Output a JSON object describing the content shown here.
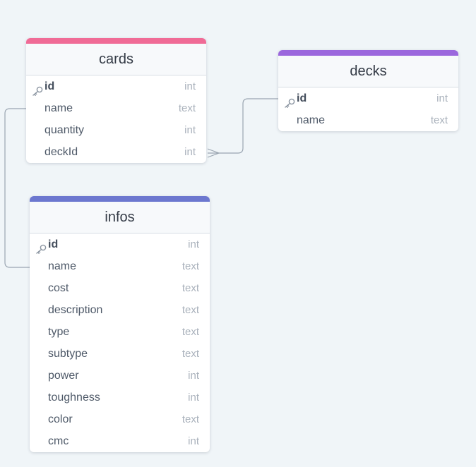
{
  "colors": {
    "cards_accent": "#f06b96",
    "decks_accent": "#9b67dd",
    "infos_accent": "#6c77cf",
    "connector": "#9aa5b1",
    "background": "#f0f5f8"
  },
  "tables": {
    "cards": {
      "title": "cards",
      "rows": [
        {
          "name": "id",
          "type": "int",
          "pk": true
        },
        {
          "name": "name",
          "type": "text"
        },
        {
          "name": "quantity",
          "type": "int"
        },
        {
          "name": "deckId",
          "type": "int"
        }
      ]
    },
    "decks": {
      "title": "decks",
      "rows": [
        {
          "name": "id",
          "type": "int",
          "pk": true
        },
        {
          "name": "name",
          "type": "text"
        }
      ]
    },
    "infos": {
      "title": "infos",
      "rows": [
        {
          "name": "id",
          "type": "int",
          "pk": true
        },
        {
          "name": "name",
          "type": "text"
        },
        {
          "name": "cost",
          "type": "text"
        },
        {
          "name": "description",
          "type": "text"
        },
        {
          "name": "type",
          "type": "text"
        },
        {
          "name": "subtype",
          "type": "text"
        },
        {
          "name": "power",
          "type": "int"
        },
        {
          "name": "toughness",
          "type": "int"
        },
        {
          "name": "color",
          "type": "text"
        },
        {
          "name": "cmc",
          "type": "int"
        }
      ]
    }
  },
  "relations": [
    {
      "from": "cards.deckId",
      "to": "decks.id",
      "cardinality": "many-to-one"
    },
    {
      "from": "cards.name",
      "to": "infos.name",
      "cardinality": "one-to-one"
    }
  ]
}
